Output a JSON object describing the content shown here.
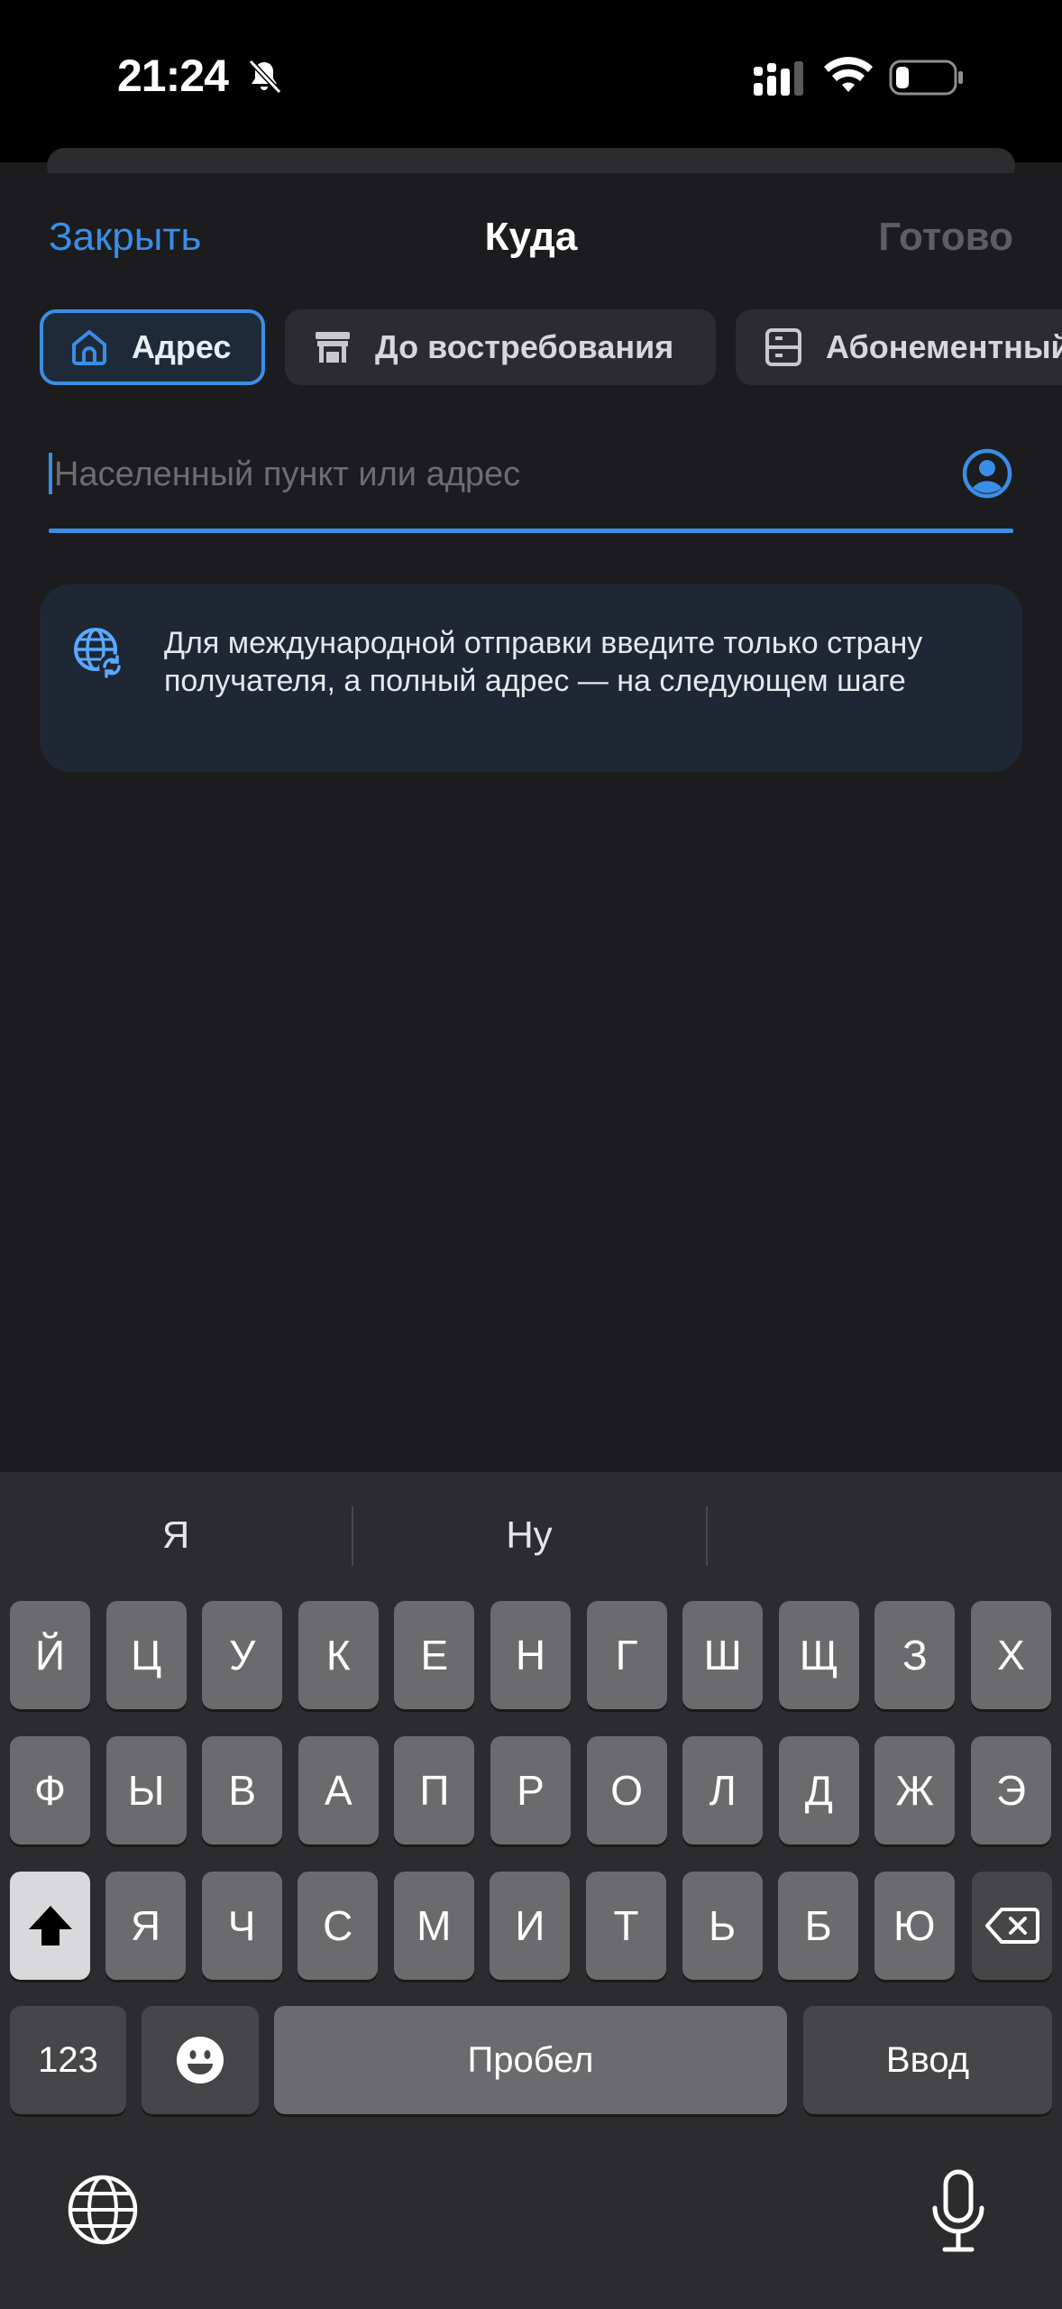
{
  "status_bar": {
    "time": "21:24"
  },
  "header": {
    "close_label": "Закрыть",
    "title": "Куда",
    "done_label": "Готово"
  },
  "tabs": [
    {
      "label": "Адрес",
      "icon": "home-icon",
      "active": true
    },
    {
      "label": "До востребования",
      "icon": "post-office-icon",
      "active": false
    },
    {
      "label": "Абонементный ящик",
      "icon": "mailbox-cabinet-icon",
      "active": false
    }
  ],
  "search": {
    "placeholder": "Населенный пункт или адрес",
    "value": ""
  },
  "info": {
    "text": "Для международной отправки введите только страну получателя, а полный адрес — на следующем шаге",
    "icon": "globe-refresh-icon"
  },
  "keyboard": {
    "suggestions": [
      "Я",
      "Ну",
      ""
    ],
    "row1": [
      "Й",
      "Ц",
      "У",
      "К",
      "Е",
      "Н",
      "Г",
      "Ш",
      "Щ",
      "З",
      "Х"
    ],
    "row2": [
      "Ф",
      "Ы",
      "В",
      "А",
      "П",
      "Р",
      "О",
      "Л",
      "Д",
      "Ж",
      "Э"
    ],
    "row3": [
      "Я",
      "Ч",
      "С",
      "М",
      "И",
      "Т",
      "Ь",
      "Б",
      "Ю"
    ],
    "numbers_label": "123",
    "space_label": "Пробел",
    "return_label": "Ввод"
  },
  "colors": {
    "accent": "#3a8ee6",
    "background": "#1c1c1e",
    "info_bg": "#1f2735",
    "keyboard_bg": "#2c2c2e"
  }
}
